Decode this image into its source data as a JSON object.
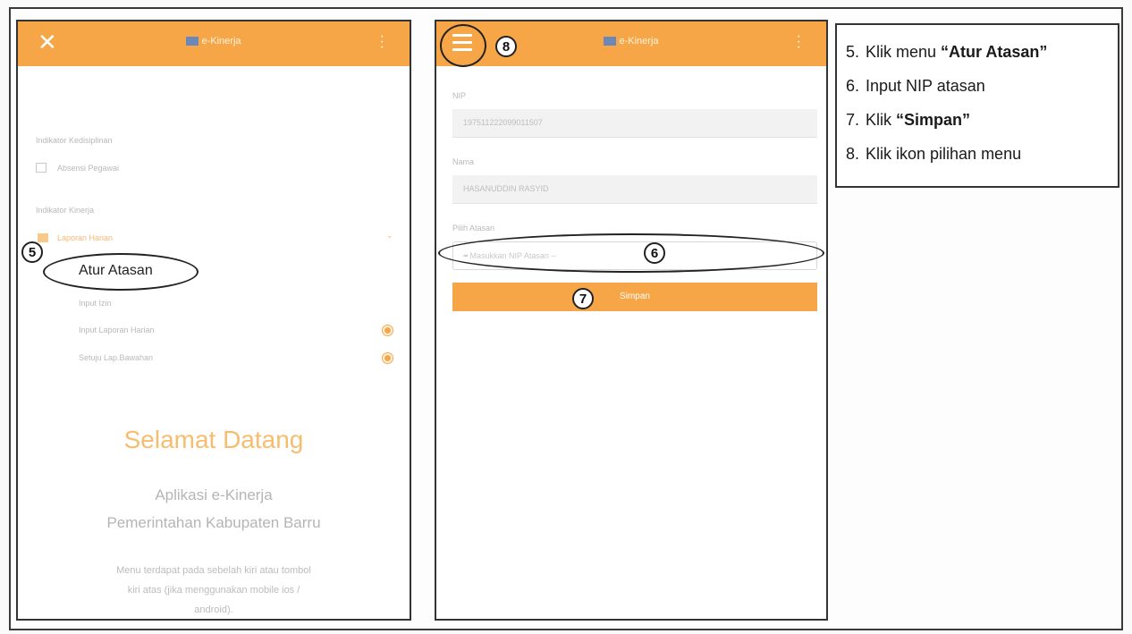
{
  "left_phone": {
    "app_title": "e-Kinerja",
    "user_info": "",
    "section_kebijakan": "Indikator Kedisiplinan",
    "item_absensi": "Absensi Pegawai",
    "section_kinerja": "Indikator Kinerja",
    "item_laporan": "Laporan Harian",
    "item_atur_atasan": "Atur Atasan",
    "item_input_izin": "Input Izin",
    "item_input_laporan": "Input Laporan Harian",
    "item_setuju": "Setuju Lap.Bawahan",
    "badge_1": "0",
    "badge_2": "0",
    "welcome_title": "Selamat Datang",
    "welcome_line1": "Aplikasi e-Kinerja",
    "welcome_line2": "Pemerintahan Kabupaten Barru",
    "welcome_desc1": "Menu terdapat pada sebelah kiri atau tombol",
    "welcome_desc2": "kiri atas (jika menggunakan mobile ios /",
    "welcome_desc3": "android)."
  },
  "right_phone": {
    "app_title": "e-Kinerja",
    "nip_label": "NIP",
    "nip_value": "197511222099011507",
    "nama_label": "Nama",
    "nama_value": "HASANUDDIN RASYID",
    "atasan_label": "Pilih Atasan",
    "atasan_placeholder": "-- Masukkan NIP Atasan --",
    "simpan_label": "Simpan"
  },
  "callouts": {
    "c5": "5",
    "c6": "6",
    "c7": "7",
    "c8": "8"
  },
  "legend": [
    {
      "num": "5.",
      "pre": "Klik menu ",
      "bold": "“Atur Atasan”",
      "post": ""
    },
    {
      "num": "6.",
      "pre": "Input NIP atasan",
      "bold": "",
      "post": ""
    },
    {
      "num": "7.",
      "pre": "Klik ",
      "bold": "“Simpan”",
      "post": ""
    },
    {
      "num": "8.",
      "pre": "Klik ikon pilihan menu",
      "bold": "",
      "post": ""
    }
  ],
  "colors": {
    "accent": "#f6a647",
    "header_text": "#fff3e0"
  }
}
